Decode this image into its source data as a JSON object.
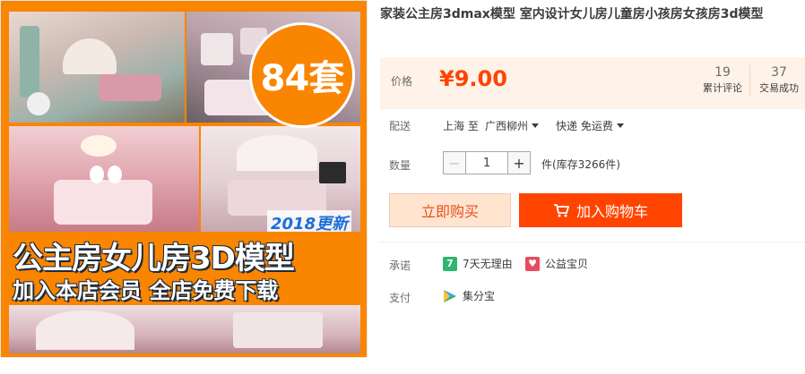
{
  "product": {
    "title": "家装公主房3dmax模型 室内设计女儿房儿童房小孩房女孩房3d模型",
    "image": {
      "count_badge": "84套",
      "year_badge": "2018更新",
      "headline": "公主房女儿房3D模型",
      "subline": "加入本店会员 全店免费下载"
    }
  },
  "price": {
    "label": "价格",
    "value": "¥9.00",
    "reviews_count": "19",
    "reviews_label": "累计评论",
    "sales_count": "37",
    "sales_label": "交易成功"
  },
  "shipping": {
    "label": "配送",
    "from": "上海 至",
    "to": "广西柳州",
    "method": "快递 免运费"
  },
  "quantity": {
    "label": "数量",
    "minus": "−",
    "value": "1",
    "plus": "+",
    "stock": "件(库存3266件)"
  },
  "actions": {
    "buy_now": "立即购买",
    "add_to_cart": "加入购物车"
  },
  "promise": {
    "label": "承诺",
    "items": [
      {
        "icon": "seven-days-icon",
        "icon_glyph": "7",
        "text": "7天无理由",
        "color": "#2bb673"
      },
      {
        "icon": "charity-icon",
        "icon_glyph": "♥",
        "text": "公益宝贝",
        "color": "#e84a5f"
      }
    ]
  },
  "payment": {
    "label": "支付",
    "method": "集分宝",
    "icon": "jifenbao-icon"
  },
  "colors": {
    "accent": "#ff4400",
    "price": "#ff4400",
    "image_orange": "#f98500"
  }
}
